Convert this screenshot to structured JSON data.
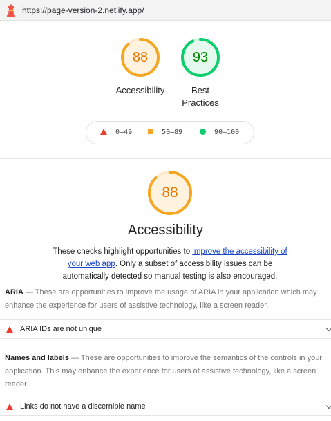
{
  "browser": {
    "url": "https://page-version-2.netlify.app/"
  },
  "scores": [
    {
      "label": "Accessibility",
      "score": 88,
      "color": "#f5a623"
    },
    {
      "label_line1": "Best",
      "label_line2": "Practices",
      "score": 93,
      "color": "#0cce6b"
    }
  ],
  "legend": {
    "fail": "0–49",
    "average": "50–89",
    "pass": "90–100"
  },
  "category": {
    "score": 88,
    "title": "Accessibility",
    "desc_before": "These checks highlight opportunities to ",
    "desc_link": "improve the accessibility of your web app",
    "desc_after": ". Only a subset of accessibility issues can be automatically detected so manual testing is also encouraged."
  },
  "groups": [
    {
      "title": "ARIA",
      "description": " — These are opportunities to improve the usage of ARIA in your application which may enhance the experience for users of assistive technology, like a screen reader.",
      "audit": "ARIA IDs are not unique"
    },
    {
      "title": "Names and labels",
      "description": " — These are opportunities to improve the semantics of the controls in your application. This may enhance the experience for users of assistive technology, like a screen reader.",
      "audit": "Links do not have a discernible name"
    }
  ]
}
